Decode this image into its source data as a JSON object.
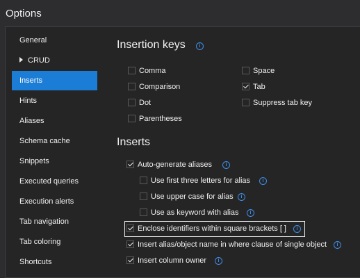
{
  "window": {
    "title": "Options"
  },
  "nav": {
    "items": [
      {
        "label": "General",
        "expander": false,
        "active": false
      },
      {
        "label": "CRUD",
        "expander": true,
        "active": false
      },
      {
        "label": "Inserts",
        "expander": false,
        "active": true
      },
      {
        "label": "Hints",
        "expander": false,
        "active": false
      },
      {
        "label": "Aliases",
        "expander": false,
        "active": false
      },
      {
        "label": "Schema cache",
        "expander": false,
        "active": false
      },
      {
        "label": "Snippets",
        "expander": false,
        "active": false
      },
      {
        "label": "Executed queries",
        "expander": false,
        "active": false
      },
      {
        "label": "Execution alerts",
        "expander": false,
        "active": false
      },
      {
        "label": "Tab navigation",
        "expander": false,
        "active": false
      },
      {
        "label": "Tab coloring",
        "expander": false,
        "active": false
      },
      {
        "label": "Shortcuts",
        "expander": false,
        "active": false
      }
    ]
  },
  "insertion_keys": {
    "title": "Insertion keys",
    "info_icon": "info-icon",
    "options": [
      {
        "label": "Comma",
        "checked": false
      },
      {
        "label": "Comparison",
        "checked": false
      },
      {
        "label": "Dot",
        "checked": false
      },
      {
        "label": "Parentheses",
        "checked": false
      },
      {
        "label": "Space",
        "checked": false
      },
      {
        "label": "Tab",
        "checked": true
      },
      {
        "label": "Suppress tab key",
        "checked": false
      }
    ]
  },
  "inserts": {
    "title": "Inserts",
    "options": [
      {
        "label": "Auto-generate aliases",
        "checked": true,
        "info": true
      },
      {
        "label": "Use first three letters for alias",
        "checked": false,
        "info": true
      },
      {
        "label": "Use upper case for alias",
        "checked": false,
        "info": true
      },
      {
        "label": "Use as keyword with alias",
        "checked": false,
        "info": true
      },
      {
        "label": "Enclose identifiers within square brackets [ ]",
        "checked": true,
        "info": true
      },
      {
        "label": "Insert alias/object name in where clause of single object",
        "checked": true,
        "info": true
      },
      {
        "label": "Insert column owner",
        "checked": true,
        "info": true
      }
    ]
  },
  "colors": {
    "accent": "#1c7dd6",
    "info": "#3d8ee8",
    "background": "#252526"
  }
}
